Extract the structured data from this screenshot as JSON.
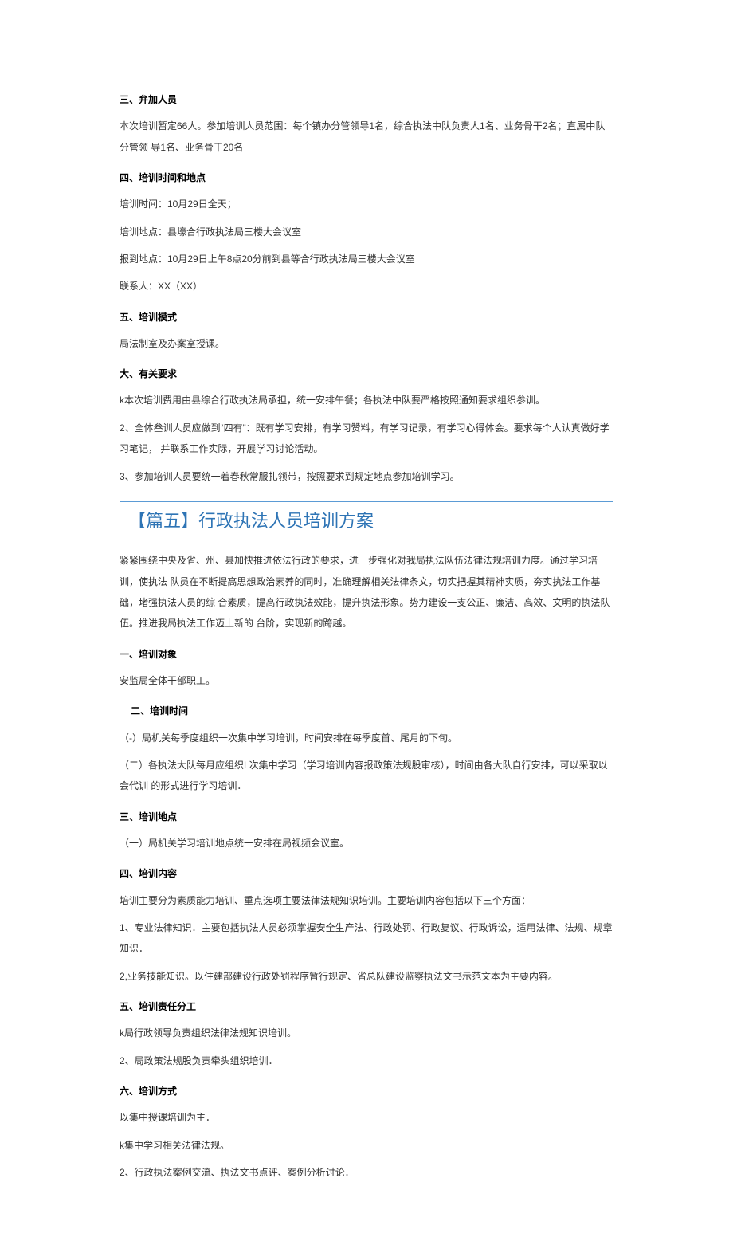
{
  "s1": {
    "h_participants": "三、弁加人员",
    "p_participants": "本次培训暂定66人。参加培训人员范围：每个镇办分管领导1名，综合执法中队负责人1名、业务骨干2名；直属中队分管领 导1名、业务骨干20名",
    "h_time_place": "四、培训时间和地点",
    "p_time": "培训时间：10月29日全天；",
    "p_place": "培训地点：县壕合行政执法局三楼大会议室",
    "p_checkin": "报到地点：10月29日上午8点20分前到县等合行政执法局三楼大会议室",
    "p_contact": "联系人：XX（XX）",
    "h_mode": "五、培训模式",
    "p_mode": "局法制室及办案室授课。",
    "h_req": "大、有关要求",
    "p_req1": "k本次培训费用由县综合行政执法局承担，统一安排午餐；各执法中队要严格按照通知要求组织参训。",
    "p_req2": "2、全体叁训人员应做到“四有”：既有学习安排，有学习赞料，有学习记录，有学习心得体会。要求每个人认真做好学习笔记， 并联系工作实际，开展学习讨论活动。",
    "p_req3": "3、参加培训人员要统一着春秋常服扎领带，按照要求到规定地点参加培训学习。"
  },
  "section5": {
    "bracket": "【篇五】",
    "title": "行政执法人员培训方案"
  },
  "s2": {
    "intro": "紧紧围绕中央及省、州、县加快推进依法行政的要求，进一步强化对我局执法队伍法律法规培训力度。通过学习培训，使执法 队员在不断提高思想政治素养的同时，准确理解相关法律条文，切实把握其精神实质，夯实执法工作基础，堵强执法人员的综 合素质，提高行政执法效能，提升执法形象。势力建设一支公正、廉洁、高效、文明的执法队伍。推进我局执法工作迈上新的 台阶，实现新的跨越。",
    "h_target": "一、培训对象",
    "p_target": "安监局全体干部职工。",
    "h_time": "二、培训时间",
    "p_time1": "（-）局机关每季度组织一次集中学习培训，时间安排在每季度首、尾月的下旬。",
    "p_time2": "（二）各执法大队每月应组织L次集中学习（学习培训内容报政策法规股审核），时间由各大队自行安排，可以采取以会代训 的形式进行学习培训．",
    "h_place": "三、培训地点",
    "p_place1": "（一）局机关学习培训地点统一安排在局视频会议室。",
    "h_content": "四、培训内容",
    "p_content_intro": "培训主要分为素质能力培训、重点选项主要法律法规知识培训。主要培训内容包括以下三个方面：",
    "p_content1": "1、专业法律知识．主要包括执法人员必须掌握安全生产法、行政处罚、行政复议、行政诉讼，适用法律、法规、规章知识．",
    "p_content2": "2,业务技能知识。以住建部建设行政处罚程序暂行规定、省总队建设监察执法文书示范文本为主要内容。",
    "h_duty": "五、培训责任分工",
    "p_duty1": "k局行政领导负责组织法律法规知识培训。",
    "p_duty2": "2、局政策法规股负责牵头组织培训．",
    "h_method": "六、培训方式",
    "p_method_intro": "以集中授课培训为主．",
    "p_method1": "k集中学习相关法律法规。",
    "p_method2": "2、行政执法案例交流、执法文书点评、案例分析讨论．"
  }
}
